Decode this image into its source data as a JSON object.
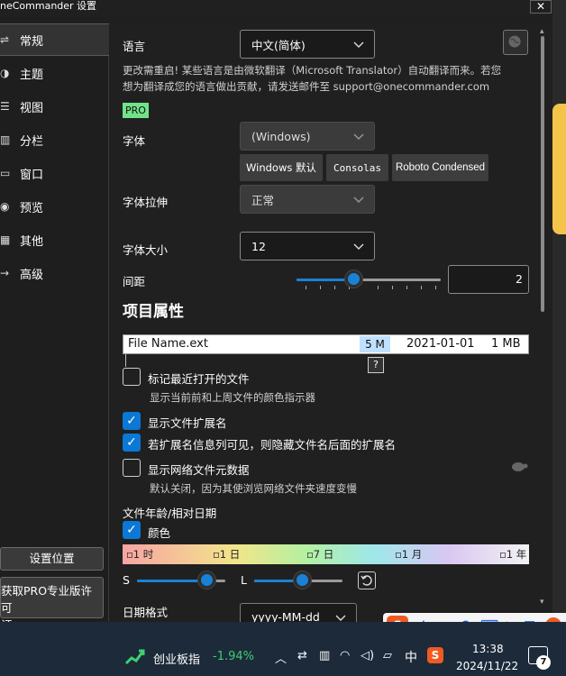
{
  "window": {
    "title": "neCommander 设置",
    "close_label": "✕"
  },
  "sidebar": {
    "items": [
      {
        "label": "常规",
        "icon": "toggles-icon",
        "glyph": "⇌"
      },
      {
        "label": "主题",
        "icon": "palette-icon",
        "glyph": "◑"
      },
      {
        "label": "视图",
        "icon": "list-icon",
        "glyph": "☰"
      },
      {
        "label": "分栏",
        "icon": "columns-icon",
        "glyph": "▥"
      },
      {
        "label": "窗口",
        "icon": "window-icon",
        "glyph": "▭"
      },
      {
        "label": "预览",
        "icon": "eye-icon",
        "glyph": "◉"
      },
      {
        "label": "其他",
        "icon": "grid-icon",
        "glyph": "▦"
      },
      {
        "label": "高级",
        "icon": "arrow-right-icon",
        "glyph": "→"
      }
    ],
    "active_index": 0,
    "buttons": {
      "settings_location": "设置位置",
      "get_pro_line1": "获取PRO专业版许可",
      "get_pro_line2": "证"
    }
  },
  "settings": {
    "language": {
      "label": "语言",
      "value": "中文(简体)"
    },
    "translation_note_line1": "更改需重启! 某些语言是由微软翻译（Microsoft Translator）自动翻译而来。若您",
    "translation_note_line2": "想为翻译成您的语言做出贡献，请发送邮件至 support@onecommander.com",
    "pro_badge": "PRO",
    "font": {
      "label": "字体",
      "value": "(Windows)",
      "presets": [
        "Windows 默认",
        "Consolas",
        "Roboto Condensed"
      ]
    },
    "font_stretch": {
      "label": "字体拉伸",
      "value": "正常"
    },
    "font_size": {
      "label": "字体大小",
      "value": "12"
    },
    "spacing": {
      "label": "间距",
      "value": "2",
      "slider_fraction": 0.4
    },
    "item_properties": {
      "heading": "项目属性",
      "preview": {
        "name": "File Name.ext",
        "size_tag": "5 M",
        "date": "2021-01-01",
        "size": "1 MB"
      },
      "help": "?"
    },
    "checkboxes": [
      {
        "label": "标记最近打开的文件",
        "checked": false,
        "hint": "显示当前前和上周文件的颜色指示器"
      },
      {
        "label": "显示文件扩展名",
        "checked": true
      },
      {
        "label": "若扩展名信息列可见，则隐藏文件名后面的扩展名",
        "checked": true
      },
      {
        "label": "显示网络文件元数据",
        "checked": false,
        "hint": "默认关闭，因为其使浏览网络文件夹速度变慢",
        "icon": "turtle-icon"
      }
    ],
    "file_age": {
      "heading": "文件年龄/相对日期",
      "color": {
        "label": "颜色",
        "checked": true
      },
      "scale": [
        "▫1 时",
        "▫1 日",
        "▫7 日",
        "▫1 月",
        "▫1 年"
      ],
      "s_label": "S",
      "l_label": "L",
      "s_fraction": 0.8,
      "l_fraction": 0.55
    },
    "date_format": {
      "label": "日期格式",
      "value": "yyyy-MM-dd"
    }
  },
  "taskbar": {
    "stock_name": "创业板指",
    "stock_change": "-1.94%",
    "time": "13:38",
    "date": "2024/11/22",
    "ime_lang": "中",
    "notification_count": "7",
    "ime_bar": [
      "中",
      "·,",
      "🎤",
      "⌨",
      "👕",
      "▦"
    ]
  },
  "colors": {
    "accent": "#0a78d4",
    "pro": "#72e28a",
    "stock_down": "#3fcf6f"
  }
}
